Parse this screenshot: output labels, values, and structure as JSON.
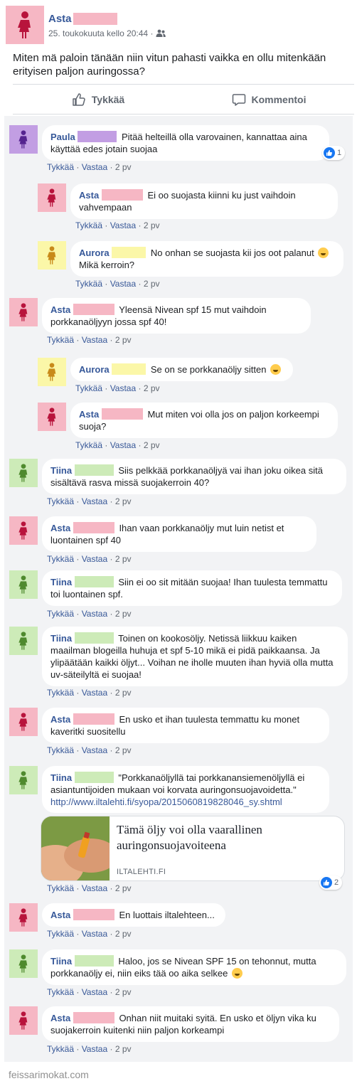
{
  "colors": {
    "pink": "#f6b7c4",
    "purple": "#c29ee3",
    "yellow": "#fbf7a8",
    "green": "#cdebb8",
    "link": "#365899"
  },
  "post": {
    "author": "Asta",
    "timestamp": "25. toukokuuta kello 20:44 ·",
    "audience_icon": "friends-icon",
    "text": "Miten mä paloin tänään niin vitun pahasti vaikka en ollu mitenkään erityisen paljon auringossa?",
    "like_label": "Tykkää",
    "comment_label": "Kommentoi"
  },
  "meta_labels": {
    "like": "Tykkää",
    "reply": "Vastaa",
    "age": "2 pv"
  },
  "comments": [
    {
      "author": "Paula",
      "text": "Pitää helteillä olla varovainen, kannattaa aina käyttää edes jotain suojaa",
      "reactions": "1"
    },
    {
      "author": "Asta",
      "text": "Ei oo suojasta kiinni ku just vaihdoin vahvempaan"
    },
    {
      "author": "Aurora",
      "text": "No onhan se suojasta kii jos oot palanut",
      "text_after": "Mikä kerroin?"
    },
    {
      "author": "Asta",
      "text": "Yleensä Nivean spf 15 mut vaihdoin porkkanaöljyyn jossa spf 40!"
    },
    {
      "author": "Aurora",
      "text": "Se on se porkkanaöljy sitten"
    },
    {
      "author": "Asta",
      "text": "Mut miten voi olla jos on paljon korkeempi suoja?"
    },
    {
      "author": "Tiina",
      "text": "Siis pelkkää porkkanaöljyä vai ihan joku oikea sitä sisältävä rasva missä suojakerroin 40?"
    },
    {
      "author": "Asta",
      "text": "Ihan vaan porkkanaöljy mut luin netist et luontainen spf 40"
    },
    {
      "author": "Tiina",
      "text": "Siin ei oo sit mitään suojaa! Ihan tuulesta temmattu toi luontainen spf."
    },
    {
      "author": "Tiina",
      "text": "Toinen on kookosöljy. Netissä liikkuu kaiken maailman blogeilla huhuja et spf 5-10 mikä ei pidä paikkaansa. Ja ylipäätään kaikki öljyt... Voihan ne iholle muuten ihan hyviä olla mutta uv-säteilyltä ei suojaa!"
    },
    {
      "author": "Asta",
      "text": "En usko et ihan tuulesta temmattu ku monet kaveritki suositellu"
    },
    {
      "author": "Tiina",
      "text": "\"Porkkanaöljyllä tai porkkanansiemenöljyllä ei asiantuntijoiden mukaan voi korvata auringonsuojavoidetta.\"",
      "link": "http://www.iltalehti.fi/syopa/2015060819828046_sy.shtml",
      "reactions": "2"
    },
    {
      "author": "Asta",
      "text": "En luottais iltalehteen..."
    },
    {
      "author": "Tiina",
      "text": "Haloo, jos se Nivean SPF 15 on tehonnut, mutta porkkanaöljy ei, niin eiks tää oo aika selkee"
    },
    {
      "author": "Asta",
      "text": "Onhan niit muitaki syitä. En usko et öljyn vika ku suojakerroin kuitenki niin paljon korkeampi"
    }
  ],
  "link_preview": {
    "title": "Tämä öljy voi olla vaarallinen auringonsuojavoiteena",
    "domain": "ILTALEHTI.FI"
  },
  "footer": "feissarimokat.com"
}
